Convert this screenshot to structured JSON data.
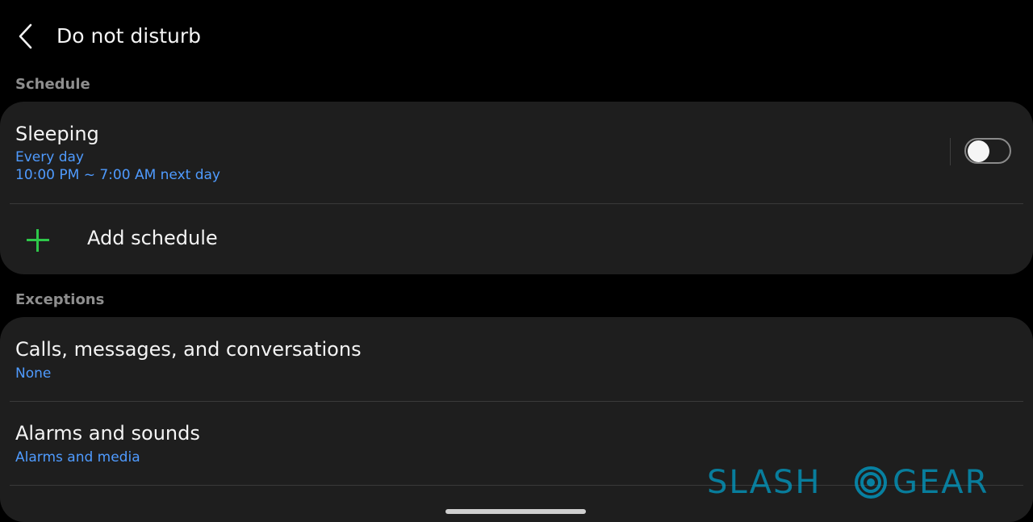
{
  "header": {
    "title": "Do not disturb",
    "back_icon": "chevron-left-icon"
  },
  "schedule": {
    "label": "Schedule",
    "items": [
      {
        "title": "Sleeping",
        "days": "Every day",
        "time": "10:00 PM ~ 7:00 AM next day",
        "enabled": false
      }
    ],
    "add_label": "Add schedule",
    "add_icon": "plus-icon",
    "add_icon_color": "#2ec84a"
  },
  "exceptions": {
    "label": "Exceptions",
    "items": [
      {
        "title": "Calls, messages, and conversations",
        "subtitle": "None"
      },
      {
        "title": "Alarms and sounds",
        "subtitle": "Alarms and media"
      }
    ]
  },
  "watermark": {
    "left": "SLASH",
    "right": "GEAR",
    "color": "#00a2cd"
  },
  "colors": {
    "background": "#000000",
    "card": "#1e1e1e",
    "accent_text": "#4f9bff"
  }
}
